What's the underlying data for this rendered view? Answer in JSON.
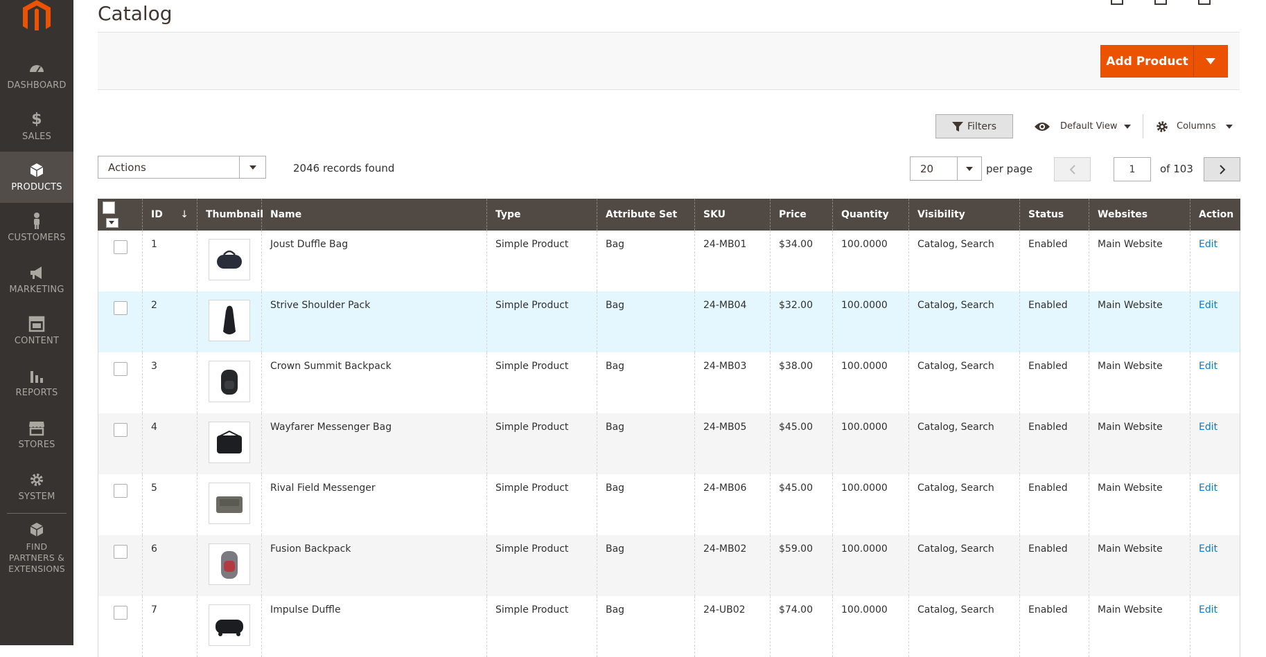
{
  "sidebar": {
    "items": [
      {
        "label": "DASHBOARD",
        "icon": "dashboard-icon"
      },
      {
        "label": "SALES",
        "icon": "dollar-icon"
      },
      {
        "label": "PRODUCTS",
        "icon": "cube-icon"
      },
      {
        "label": "CUSTOMERS",
        "icon": "person-icon"
      },
      {
        "label": "MARKETING",
        "icon": "megaphone-icon"
      },
      {
        "label": "CONTENT",
        "icon": "layout-icon"
      },
      {
        "label": "REPORTS",
        "icon": "bar-chart-icon"
      },
      {
        "label": "STORES",
        "icon": "store-icon"
      },
      {
        "label": "SYSTEM",
        "icon": "gear-icon"
      },
      {
        "label": "FIND PARTNERS & EXTENSIONS",
        "icon": "boxes-icon"
      }
    ],
    "active": "PRODUCTS"
  },
  "header": {
    "title": "Catalog"
  },
  "action_bar": {
    "add_product_label": "Add Product"
  },
  "toolbar": {
    "filters_label": "Filters",
    "view_label": "Default View",
    "columns_label": "Columns",
    "actions_value": "Actions",
    "records_found": "2046 records found",
    "per_page_value": "20",
    "per_page_label": "per page",
    "current_page": "1",
    "page_of": "of 103"
  },
  "colors": {
    "accent": "#eb5202",
    "sidebar_bg": "#373330",
    "header_bg": "#514943",
    "link": "#007bdb"
  },
  "table": {
    "columns": [
      "ID",
      "Thumbnail",
      "Name",
      "Type",
      "Attribute Set",
      "SKU",
      "Price",
      "Quantity",
      "Visibility",
      "Status",
      "Websites",
      "Action"
    ],
    "sort_indicator": "↓",
    "rows": [
      {
        "id": "1",
        "name": "Joust Duffle Bag",
        "type": "Simple Product",
        "attr": "Bag",
        "sku": "24-MB01",
        "price": "$34.00",
        "qty": "100.0000",
        "visibility": "Catalog, Search",
        "status": "Enabled",
        "website": "Main Website",
        "action": "Edit"
      },
      {
        "id": "2",
        "name": "Strive Shoulder Pack",
        "type": "Simple Product",
        "attr": "Bag",
        "sku": "24-MB04",
        "price": "$32.00",
        "qty": "100.0000",
        "visibility": "Catalog, Search",
        "status": "Enabled",
        "website": "Main Website",
        "action": "Edit"
      },
      {
        "id": "3",
        "name": "Crown Summit Backpack",
        "type": "Simple Product",
        "attr": "Bag",
        "sku": "24-MB03",
        "price": "$38.00",
        "qty": "100.0000",
        "visibility": "Catalog, Search",
        "status": "Enabled",
        "website": "Main Website",
        "action": "Edit"
      },
      {
        "id": "4",
        "name": "Wayfarer Messenger Bag",
        "type": "Simple Product",
        "attr": "Bag",
        "sku": "24-MB05",
        "price": "$45.00",
        "qty": "100.0000",
        "visibility": "Catalog, Search",
        "status": "Enabled",
        "website": "Main Website",
        "action": "Edit"
      },
      {
        "id": "5",
        "name": "Rival Field Messenger",
        "type": "Simple Product",
        "attr": "Bag",
        "sku": "24-MB06",
        "price": "$45.00",
        "qty": "100.0000",
        "visibility": "Catalog, Search",
        "status": "Enabled",
        "website": "Main Website",
        "action": "Edit"
      },
      {
        "id": "6",
        "name": "Fusion Backpack",
        "type": "Simple Product",
        "attr": "Bag",
        "sku": "24-MB02",
        "price": "$59.00",
        "qty": "100.0000",
        "visibility": "Catalog, Search",
        "status": "Enabled",
        "website": "Main Website",
        "action": "Edit"
      },
      {
        "id": "7",
        "name": "Impulse Duffle",
        "type": "Simple Product",
        "attr": "Bag",
        "sku": "24-UB02",
        "price": "$74.00",
        "qty": "100.0000",
        "visibility": "Catalog, Search",
        "status": "Enabled",
        "website": "Main Website",
        "action": "Edit"
      }
    ]
  }
}
